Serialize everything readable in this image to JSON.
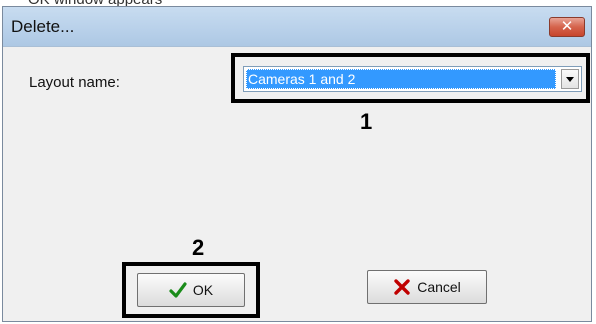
{
  "background_caption": "OK window appears",
  "window": {
    "title": "Delete...",
    "close_icon": "close-icon"
  },
  "form": {
    "layout_label": "Layout name:",
    "layout_value": "Cameras 1 and 2",
    "dropdown_icon": "chevron-down-icon"
  },
  "callouts": {
    "step1": "1",
    "step2": "2"
  },
  "buttons": {
    "ok_label": "OK",
    "ok_icon": "checkmark-icon",
    "cancel_label": "Cancel",
    "cancel_icon": "x-cross-icon"
  },
  "colors": {
    "selection": "#3399ff",
    "close_button": "#d5634c",
    "ok_icon": "#1a8c1a",
    "cancel_icon": "#c00000"
  }
}
